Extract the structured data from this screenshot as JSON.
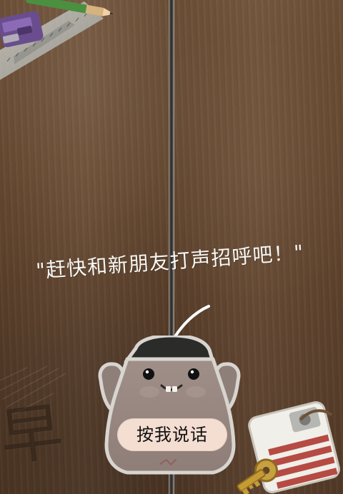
{
  "hint": {
    "text": "\"赶快和新朋友打声招呼吧！\""
  },
  "button": {
    "label": "按我说话"
  },
  "decor": {
    "stamp_char": "早"
  },
  "icons": {
    "arrow": "curved-arrow-icon",
    "mascot": "cup-mascot-icon",
    "supplies": "stationery-icon",
    "key": "key-icon"
  },
  "colors": {
    "wood_dark": "#563c28",
    "wood_mid": "#6a4b31",
    "button_fill": "#f4ddd1",
    "text_light": "#f7f7f3",
    "mascot_fill": "#9b8c86",
    "mascot_outline": "#d8d5d0"
  }
}
